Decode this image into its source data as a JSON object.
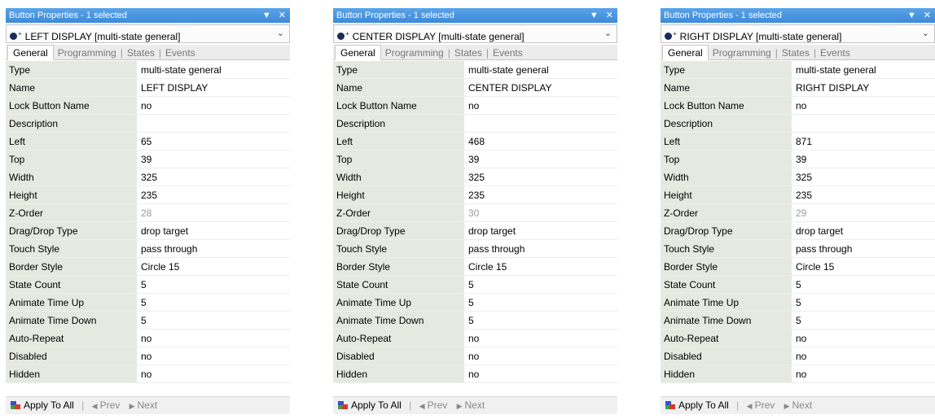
{
  "panels": [
    {
      "title": "Button Properties - 1 selected",
      "selector": "LEFT DISPLAY  [multi-state general]",
      "tabs": [
        "General",
        "Programming",
        "States",
        "Events"
      ],
      "rows": [
        {
          "key": "Type",
          "value": "multi-state general"
        },
        {
          "key": "Name",
          "value": "LEFT DISPLAY"
        },
        {
          "key": "Lock Button Name",
          "value": "no"
        },
        {
          "key": "Description",
          "value": ""
        },
        {
          "key": "Left",
          "value": "65"
        },
        {
          "key": "Top",
          "value": "39"
        },
        {
          "key": "Width",
          "value": "325"
        },
        {
          "key": "Height",
          "value": "235"
        },
        {
          "key": "Z-Order",
          "value": "28",
          "dim": true
        },
        {
          "key": "Drag/Drop Type",
          "value": "drop target"
        },
        {
          "key": "Touch Style",
          "value": "pass through"
        },
        {
          "key": "Border Style",
          "value": "Circle 15"
        },
        {
          "key": "State Count",
          "value": "5"
        },
        {
          "key": "Animate Time Up",
          "value": "5"
        },
        {
          "key": "Animate Time Down",
          "value": "5"
        },
        {
          "key": "Auto-Repeat",
          "value": "no"
        },
        {
          "key": "Disabled",
          "value": "no"
        },
        {
          "key": "Hidden",
          "value": "no"
        }
      ],
      "footer": {
        "apply": "Apply To All",
        "prev": "Prev",
        "next": "Next"
      }
    },
    {
      "title": "Button Properties - 1 selected",
      "selector": "CENTER DISPLAY  [multi-state general]",
      "tabs": [
        "General",
        "Programming",
        "States",
        "Events"
      ],
      "rows": [
        {
          "key": "Type",
          "value": "multi-state general"
        },
        {
          "key": "Name",
          "value": "CENTER DISPLAY"
        },
        {
          "key": "Lock Button Name",
          "value": "no"
        },
        {
          "key": "Description",
          "value": ""
        },
        {
          "key": "Left",
          "value": "468"
        },
        {
          "key": "Top",
          "value": "39"
        },
        {
          "key": "Width",
          "value": "325"
        },
        {
          "key": "Height",
          "value": "235"
        },
        {
          "key": "Z-Order",
          "value": "30",
          "dim": true
        },
        {
          "key": "Drag/Drop Type",
          "value": "drop target"
        },
        {
          "key": "Touch Style",
          "value": "pass through"
        },
        {
          "key": "Border Style",
          "value": "Circle 15"
        },
        {
          "key": "State Count",
          "value": "5"
        },
        {
          "key": "Animate Time Up",
          "value": "5"
        },
        {
          "key": "Animate Time Down",
          "value": "5"
        },
        {
          "key": "Auto-Repeat",
          "value": "no"
        },
        {
          "key": "Disabled",
          "value": "no"
        },
        {
          "key": "Hidden",
          "value": "no"
        }
      ],
      "footer": {
        "apply": "Apply To All",
        "prev": "Prev",
        "next": "Next"
      }
    },
    {
      "title": "Button Properties - 1 selected",
      "selector": "RIGHT DISPLAY  [multi-state general]",
      "tabs": [
        "General",
        "Programming",
        "States",
        "Events"
      ],
      "rows": [
        {
          "key": "Type",
          "value": "multi-state general"
        },
        {
          "key": "Name",
          "value": "RIGHT DISPLAY"
        },
        {
          "key": "Lock Button Name",
          "value": "no"
        },
        {
          "key": "Description",
          "value": ""
        },
        {
          "key": "Left",
          "value": "871"
        },
        {
          "key": "Top",
          "value": "39"
        },
        {
          "key": "Width",
          "value": "325"
        },
        {
          "key": "Height",
          "value": "235"
        },
        {
          "key": "Z-Order",
          "value": "29",
          "dim": true
        },
        {
          "key": "Drag/Drop Type",
          "value": "drop target"
        },
        {
          "key": "Touch Style",
          "value": "pass through"
        },
        {
          "key": "Border Style",
          "value": "Circle 15"
        },
        {
          "key": "State Count",
          "value": "5"
        },
        {
          "key": "Animate Time Up",
          "value": "5"
        },
        {
          "key": "Animate Time Down",
          "value": "5"
        },
        {
          "key": "Auto-Repeat",
          "value": "no"
        },
        {
          "key": "Disabled",
          "value": "no"
        },
        {
          "key": "Hidden",
          "value": "no"
        }
      ],
      "footer": {
        "apply": "Apply To All",
        "prev": "Prev",
        "next": "Next"
      }
    }
  ],
  "colors": {
    "titlebar": "#3d8ad9",
    "key_column": "#e5e9df",
    "dim_value": "#999999"
  },
  "icons": [
    "dropdown-arrow-icon",
    "close-icon",
    "button-object-icon",
    "chevron-down-icon",
    "apply-to-all-icon",
    "prev-arrow-icon",
    "next-arrow-icon"
  ]
}
